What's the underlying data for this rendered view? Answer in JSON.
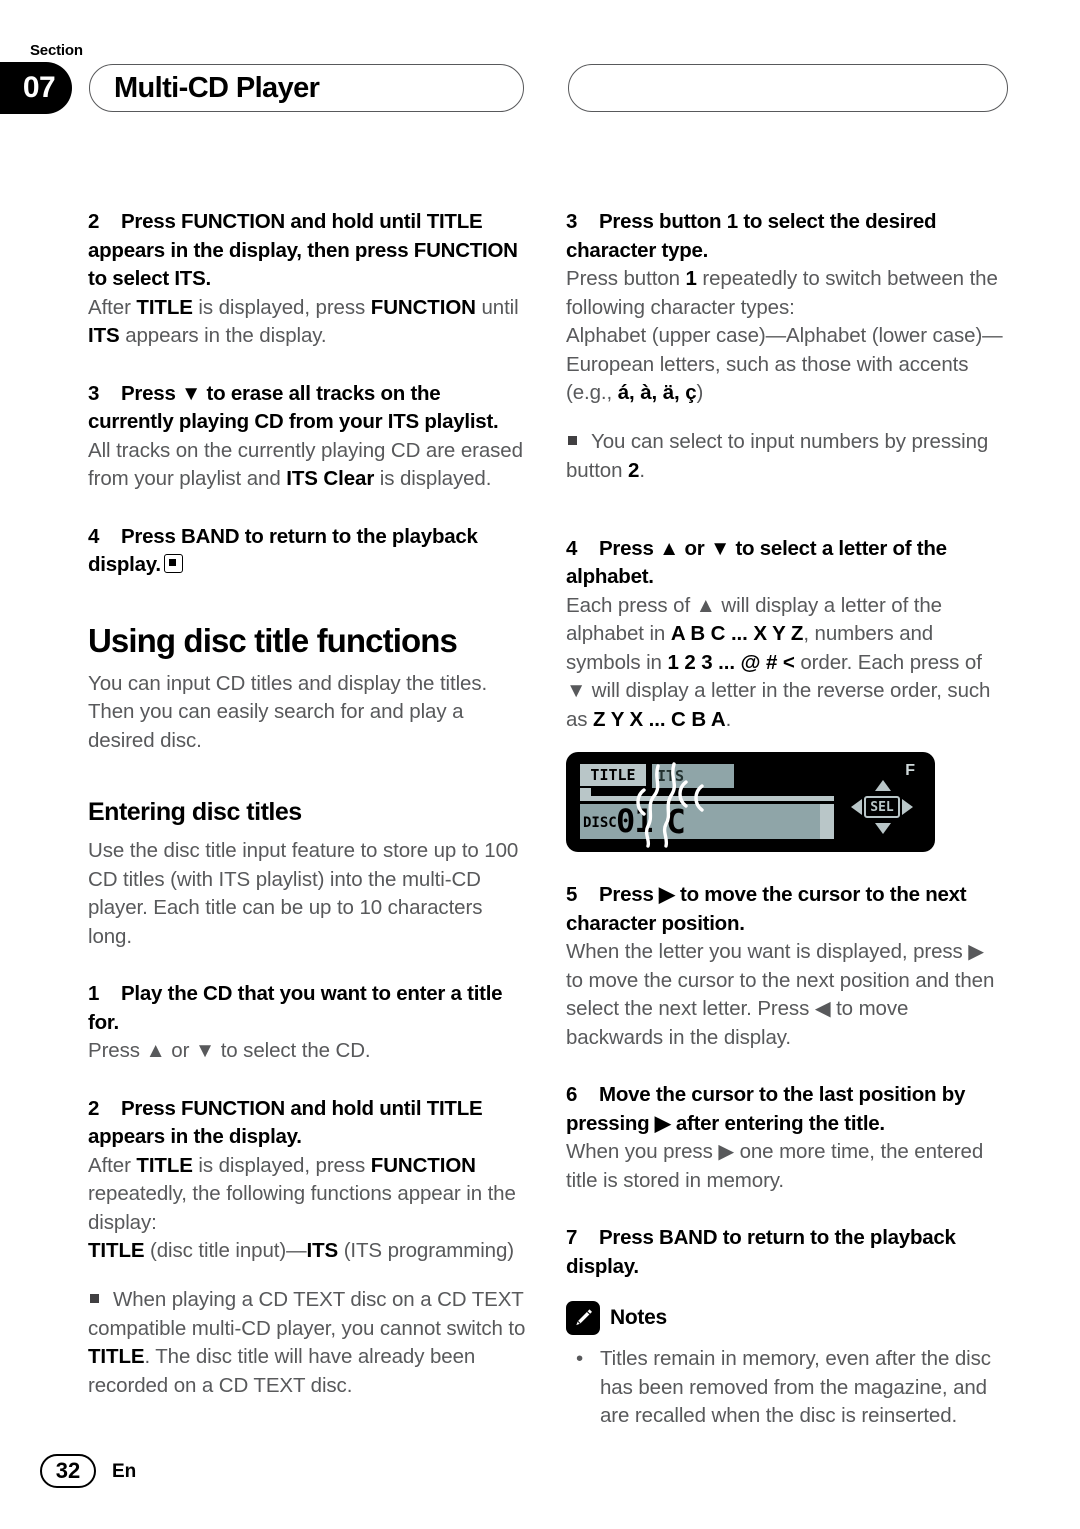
{
  "header": {
    "section_word": "Section",
    "section_number": "07",
    "title": "Multi-CD Player",
    "right_pill": ""
  },
  "left_column": {
    "step2": {
      "num": "2",
      "heading": "Press FUNCTION and hold until TITLE appears in the display, then press FUNCTION to select ITS.",
      "body_parts": [
        {
          "t": "After ",
          "b": false
        },
        {
          "t": "TITLE",
          "b": true
        },
        {
          "t": " is displayed, press ",
          "b": false
        },
        {
          "t": "FUNCTION",
          "b": true
        },
        {
          "t": " until ",
          "b": false
        },
        {
          "t": "ITS",
          "b": true
        },
        {
          "t": " appears in the display.",
          "b": false
        }
      ]
    },
    "step3": {
      "num": "3",
      "heading": "Press ▼ to erase all tracks on the currently playing CD from your ITS playlist.",
      "body_parts": [
        {
          "t": "All tracks on the currently playing CD are erased from your playlist and ",
          "b": false
        },
        {
          "t": "ITS Clear",
          "b": true
        },
        {
          "t": " is displayed.",
          "b": false
        }
      ]
    },
    "step4": {
      "num": "4",
      "heading": "Press BAND to return to the playback display."
    },
    "h1_using": "Using disc title functions",
    "using_body": "You can input CD titles and display the titles. Then you can easily search for and play a desired disc.",
    "h2_entering": "Entering disc titles",
    "entering_body": "Use the disc title input feature to store up to 100 CD titles  (with ITS playlist) into the multi-CD player. Each title can be up to 10 characters long.",
    "step1b": {
      "num": "1",
      "heading": "Play the CD that you want to enter a title for.",
      "body": "Press ▲ or ▼ to select the CD."
    },
    "step2b": {
      "num": "2",
      "heading": "Press FUNCTION and hold until TITLE appears in the display.",
      "body_parts": [
        {
          "t": "After ",
          "b": false
        },
        {
          "t": "TITLE",
          "b": true
        },
        {
          "t": " is displayed, press ",
          "b": false
        },
        {
          "t": "FUNCTION",
          "b": true
        },
        {
          "t": " repeatedly, the following functions appear in the display:",
          "b": false
        }
      ],
      "body_line2_parts": [
        {
          "t": "TITLE",
          "b": true
        },
        {
          "t": " (disc title input)—",
          "b": false
        },
        {
          "t": "ITS",
          "b": true
        },
        {
          "t": " (ITS programming)",
          "b": false
        }
      ],
      "note_parts": [
        {
          "t": "When playing a CD TEXT disc on a CD TEXT compatible multi-CD player, you cannot switch to ",
          "b": false
        },
        {
          "t": "TITLE",
          "b": true
        },
        {
          "t": ". The disc title will have already been recorded on a CD TEXT disc.",
          "b": false
        }
      ]
    }
  },
  "right_column": {
    "step3": {
      "num": "3",
      "heading": "Press button 1 to select the desired character type.",
      "body_parts": [
        {
          "t": "Press button ",
          "b": false
        },
        {
          "t": "1",
          "b": true
        },
        {
          "t": " repeatedly to switch between the following character types:",
          "b": false
        }
      ],
      "body_line2_parts": [
        {
          "t": "Alphabet (upper case)—Alphabet (lower case)—European letters, such as those with accents (e.g., ",
          "b": false
        },
        {
          "t": "á, à, ä, ç",
          "b": true
        },
        {
          "t": ")",
          "b": false
        }
      ],
      "note_parts": [
        {
          "t": "You can select to input numbers by pressing button ",
          "b": false
        },
        {
          "t": "2",
          "b": true
        },
        {
          "t": ".",
          "b": false
        }
      ]
    },
    "step4": {
      "num": "4",
      "heading": "Press ▲ or ▼ to select a letter of the alphabet.",
      "body_parts": [
        {
          "t": "Each press of ▲ will display a letter of the alphabet in ",
          "b": false
        },
        {
          "t": "A B C ... X Y Z",
          "b": true
        },
        {
          "t": ", numbers and symbols in ",
          "b": false
        },
        {
          "t": "1 2 3 ... @ # <",
          "b": true
        },
        {
          "t": " order. Each press of ▼ will display a letter in the reverse order, such as ",
          "b": false
        },
        {
          "t": "Z Y X ... C B A",
          "b": true
        },
        {
          "t": ".",
          "b": false
        }
      ]
    },
    "lcd": {
      "title_tag": "TITLE",
      "its_tag": "ITS",
      "disc_label": "DISC",
      "disc_number": "01",
      "character": "C",
      "f_label": "F",
      "sel_label": "SEL"
    },
    "step5": {
      "num": "5",
      "heading": "Press ▶ to move the cursor to the next character position.",
      "body": "When the letter you want is displayed, press ▶ to move the cursor to the next position and then select the next letter. Press ◀ to move backwards in the display."
    },
    "step6": {
      "num": "6",
      "heading": "Move the cursor to the last position by pressing ▶ after entering the title.",
      "body": "When you press ▶ one more time, the entered title is stored in memory."
    },
    "step7": {
      "num": "7",
      "heading": "Press BAND to return to the playback display."
    },
    "notes": {
      "label": "Notes",
      "bullet": "•",
      "items": [
        "Titles remain in memory, even after the disc has been removed from the magazine, and are recalled when the disc is reinserted."
      ]
    }
  },
  "footer": {
    "page_number": "32",
    "language": "En"
  }
}
